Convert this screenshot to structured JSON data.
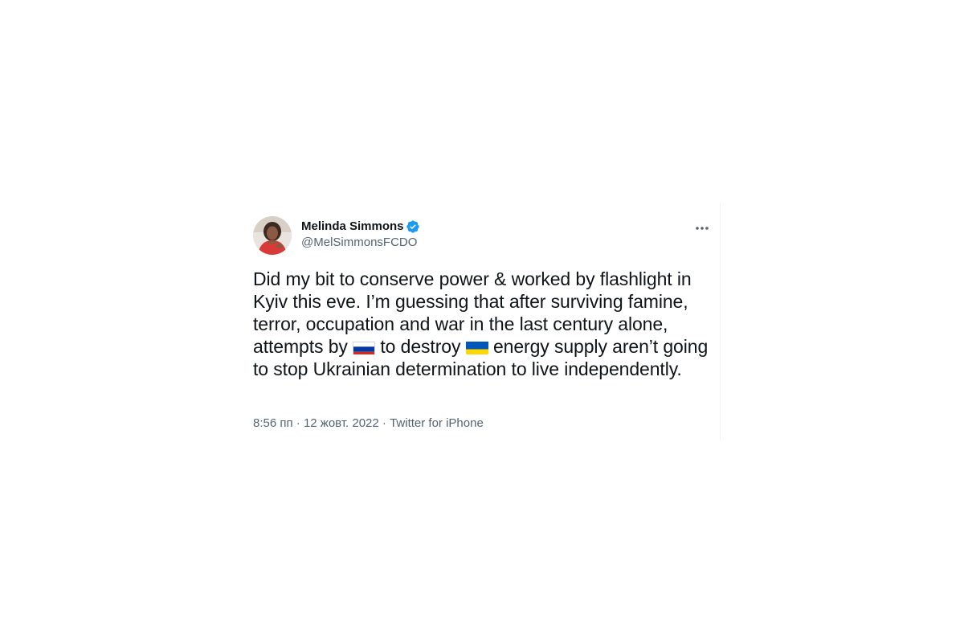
{
  "author": {
    "display_name": "Melinda Simmons",
    "handle": "@MelSimmonsFCDO",
    "verified": true
  },
  "tweet": {
    "text_part1": "Did my bit to conserve power & worked by flashlight in Kyiv this eve. I’m guessing that after surviving famine, terror, occupation and war in the last century alone, attempts by ",
    "flag1": "russia-flag",
    "text_part2": " to destroy ",
    "flag2": "ukraine-flag",
    "text_part3": " energy supply aren’t going to stop Ukrainian determination to live independently.",
    "time": "8:56 пп",
    "date": "12 жовт. 2022",
    "source": "Twitter for iPhone",
    "separator": " · "
  },
  "icons": {
    "verified_badge": "verified-badge-icon",
    "more": "more-options-icon"
  },
  "colors": {
    "text_primary": "#0f1419",
    "text_secondary": "#536471",
    "verified_blue": "#1d9bf0",
    "ukraine_blue": "#0057b7",
    "ukraine_yellow": "#ffd700",
    "russia_red": "#d52b1e",
    "russia_blue": "#0039a6"
  }
}
